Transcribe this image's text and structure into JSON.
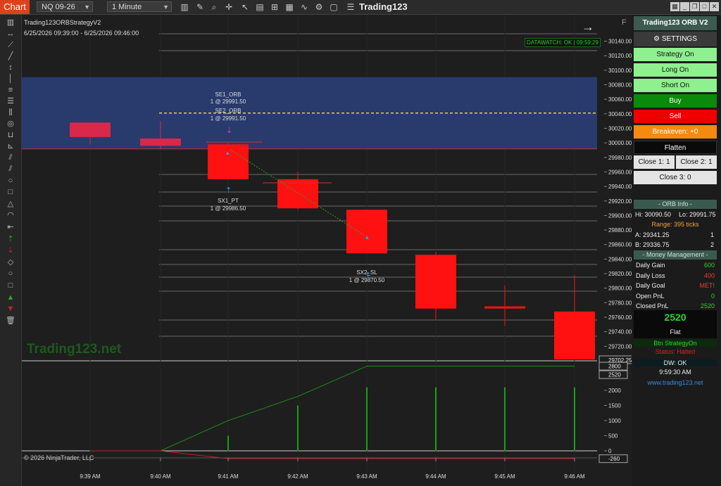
{
  "topbar": {
    "tab": "Chart",
    "instrument": "NQ 09-26",
    "interval": "1 Minute",
    "app_title": "Trading123"
  },
  "chart": {
    "strategy_name": "Trading123ORBStrategyV2",
    "date_range": "6/25/2026 09:39:00 - 6/25/2026 09:46:00",
    "datawatch": "DATAWATCH: OK | 09:59:29",
    "watermark": "Trading123.net",
    "copyright": "© 2026 NinjaTrader, LLC",
    "f_label": "F",
    "price_ticks": [
      "30140.00",
      "30120.00",
      "30100.00",
      "30080.00",
      "30060.00",
      "30040.00",
      "30020.00",
      "30000.00",
      "29980.00",
      "29960.00",
      "29940.00",
      "29920.00",
      "29900.00",
      "29880.00",
      "29860.00",
      "29840.00",
      "29820.00",
      "29800.00",
      "29780.00",
      "29760.00",
      "29740.00",
      "29720.00"
    ],
    "last_price_tag": "29702.25",
    "pnl_ticks": [
      "2000",
      "1500",
      "1000",
      "500",
      "0"
    ],
    "pnl_tag_top": "2800",
    "pnl_tag_mid": "2520",
    "pnl_tag_bottom": "-260",
    "time_labels": [
      "9:39 AM",
      "9:40 AM",
      "9:41 AM",
      "9:42 AM",
      "9:43 AM",
      "9:44 AM",
      "9:45 AM",
      "9:46 AM"
    ],
    "trades": [
      {
        "name": "SE1_ORB",
        "detail": "1 @ 29991.50"
      },
      {
        "name": "SE2_ORB",
        "detail": "1 @ 29991.50"
      },
      {
        "name": "SX1_PT",
        "detail": "1 @ 29986.50"
      },
      {
        "name": "SX2_SL",
        "detail": "1 @ 29870.50"
      }
    ],
    "colors": {
      "bear": "#ff1111",
      "orb_zone": "#2b3f7a",
      "pnl_line": "#1a8a1a",
      "neg_line": "#c02020"
    }
  },
  "chart_data": {
    "type": "candlestick",
    "categories": [
      "9:39 AM",
      "9:40 AM",
      "9:41 AM",
      "9:42 AM",
      "9:43 AM",
      "9:44 AM",
      "9:45 AM",
      "9:46 AM"
    ],
    "candles": [
      {
        "open": 30028,
        "close": 30008,
        "high": 30028,
        "low": 29998
      },
      {
        "open": 30006,
        "close": 29996,
        "high": 30030,
        "low": 29992
      },
      {
        "open": 29998,
        "close": 29950,
        "high": 30000,
        "low": 29950
      },
      {
        "open": 29950,
        "close": 29910,
        "high": 29960,
        "low": 29908
      },
      {
        "open": 29908,
        "close": 29848,
        "high": 29908,
        "low": 29848
      },
      {
        "open": 29846,
        "close": 29772,
        "high": 29850,
        "low": 29756
      },
      {
        "open": 29775,
        "close": 29773,
        "high": 29804,
        "low": 29748
      },
      {
        "open": 29768,
        "close": 29702,
        "high": 29818,
        "low": 29702
      }
    ],
    "orb_high": 30090.5,
    "orb_low": 29991.75,
    "entry_line": 30041,
    "ylim": [
      29700,
      30150
    ],
    "pnl_series": {
      "values": [
        0,
        0,
        1000,
        1800,
        2800,
        2800,
        2800,
        2800
      ]
    },
    "pnl_bars": [
      0,
      0,
      500,
      1500,
      2100,
      2100,
      2100,
      2100
    ],
    "neg_series": {
      "values": [
        0,
        0,
        -260,
        -260,
        -260,
        -260,
        -260,
        -260
      ]
    }
  },
  "panel": {
    "title": "Trading123 ORB V2",
    "settings": "SETTINGS",
    "buttons": {
      "strategy_on": "Strategy On",
      "long_on": "Long On",
      "short_on": "Short On",
      "buy": "Buy",
      "sell": "Sell",
      "breakeven": "Breakeven: +0",
      "flatten": "Flatten",
      "close1": "Close 1:  1",
      "close2": "Close 2:  1",
      "close3": "Close 3:  0"
    },
    "orb_header": "-  ORB Info  -",
    "orb_hi": "Hi: 30090.50",
    "orb_lo": "Lo: 29991.75",
    "orb_range": "Range: 395 ticks",
    "a_label": "A: 29341.25",
    "a_val": "1",
    "b_label": "B: 29336.75",
    "b_val": "2",
    "mm_header": "-  Money Management  -",
    "mm": [
      {
        "label": "Daily Gain",
        "value": "600",
        "color": "#2bd62b"
      },
      {
        "label": "Daily Loss",
        "value": "400",
        "color": "#ff3333"
      },
      {
        "label": "Daily Goal",
        "value": "MET!",
        "color": "#ff3333"
      },
      {
        "label": "Open PnL",
        "value": "0",
        "color": "#2bd62b"
      },
      {
        "label": "Closed PnL",
        "value": "2520",
        "color": "#2bd62b"
      }
    ],
    "big_pnl": "2520",
    "position": "Flat",
    "btn_status": "Btn StrategyOn",
    "status_halted": "Status: Halted",
    "dw_ok": "DW: OK",
    "time": "9:59:30 AM",
    "url": "www.trading123.net"
  }
}
